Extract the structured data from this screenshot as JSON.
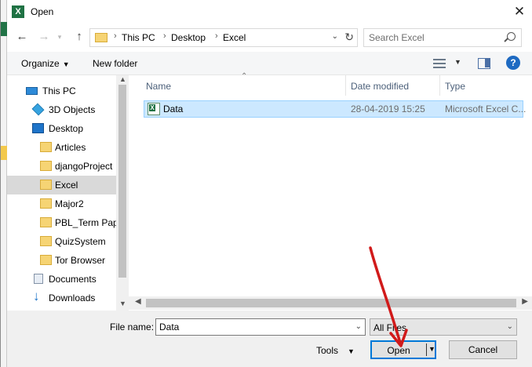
{
  "window": {
    "title": "Open",
    "app_icon": "excel-icon",
    "close_glyph": "✕"
  },
  "nav": {
    "back": "←",
    "forward": "→",
    "up": "↑"
  },
  "breadcrumb": [
    "This PC",
    "Desktop",
    "Excel"
  ],
  "breadcrumb_sep": "›",
  "search": {
    "placeholder": "Search Excel"
  },
  "toolbar": {
    "organize": "Organize",
    "new_folder": "New folder",
    "help": "?"
  },
  "sidebar": {
    "items": [
      {
        "label": "This PC",
        "icon": "pc-icon"
      },
      {
        "label": "3D Objects",
        "icon": "3d-objects-icon"
      },
      {
        "label": "Desktop",
        "icon": "desktop-icon"
      },
      {
        "label": "Articles",
        "icon": "folder-icon"
      },
      {
        "label": "djangoProject",
        "icon": "folder-icon"
      },
      {
        "label": "Excel",
        "icon": "folder-icon",
        "selected": true
      },
      {
        "label": "Major2",
        "icon": "folder-icon"
      },
      {
        "label": "PBL_Term Pape",
        "icon": "folder-icon"
      },
      {
        "label": "QuizSystem",
        "icon": "folder-icon"
      },
      {
        "label": "Tor Browser",
        "icon": "folder-icon"
      },
      {
        "label": "Documents",
        "icon": "documents-icon"
      },
      {
        "label": "Downloads",
        "icon": "downloads-icon"
      }
    ]
  },
  "files": {
    "columns": [
      "Name",
      "Date modified",
      "Type"
    ],
    "rows": [
      {
        "name": "Data",
        "date": "28-04-2019 15:25",
        "type": "Microsoft Excel C..."
      }
    ]
  },
  "bottom": {
    "file_name_label": "File name:",
    "file_name_value": "Data",
    "filter_value": "All Files",
    "tools": "Tools",
    "open": "Open",
    "cancel": "Cancel"
  },
  "colors": {
    "accent": "#0078d7",
    "selection": "#cce8ff",
    "annotation_arrow": "#d11a1a"
  }
}
